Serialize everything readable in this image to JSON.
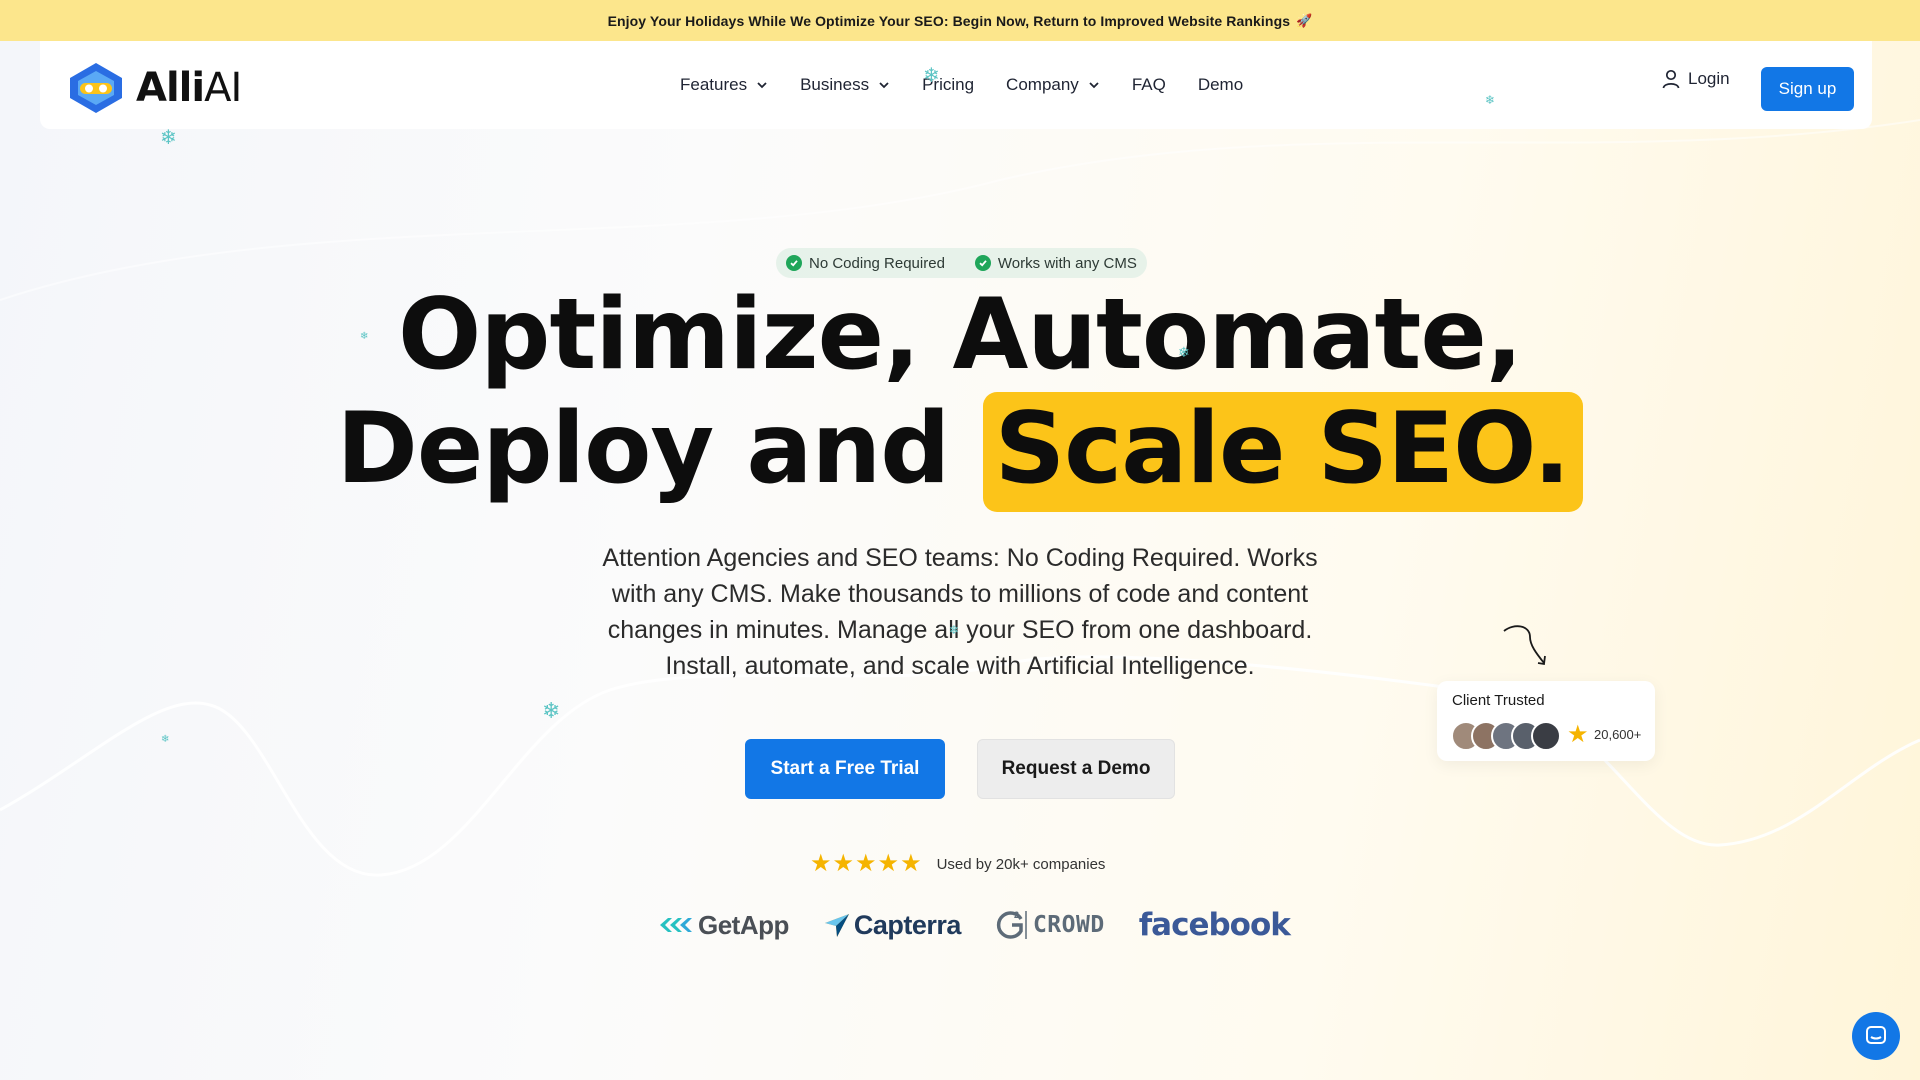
{
  "promo": {
    "text": "Enjoy Your Holidays While We Optimize Your SEO: Begin Now, Return to Improved Website Rankings",
    "icon": "rocket-icon"
  },
  "nav": {
    "logo_bold": "Alli",
    "logo_light": "AI",
    "items": [
      {
        "label": "Features",
        "dropdown": true
      },
      {
        "label": "Business",
        "dropdown": true
      },
      {
        "label": "Pricing",
        "dropdown": false
      },
      {
        "label": "Company",
        "dropdown": true
      },
      {
        "label": "FAQ",
        "dropdown": false
      },
      {
        "label": "Demo",
        "dropdown": false
      }
    ],
    "login": "Login",
    "signup": "Sign up"
  },
  "hero": {
    "badges": [
      "No Coding Required",
      "Works with any CMS"
    ],
    "headline_line1": "Optimize, Automate,",
    "headline_line2_plain": "Deploy and",
    "headline_line2_highlight": "Scale SEO.",
    "subtext": "Attention Agencies and SEO teams: No Coding Required. Works with any CMS. Make thousands to millions of code and content changes in minutes. Manage all your SEO from one dashboard. Install, automate, and scale with Artificial Intelligence.",
    "cta_primary": "Start a Free Trial",
    "cta_secondary": "Request a Demo",
    "rating_stars": 5,
    "rating_text": "Used by 20k+ companies",
    "brands": [
      "GetApp",
      "Capterra",
      "CROWD",
      "facebook"
    ]
  },
  "trust_card": {
    "title": "Client Trusted",
    "count": "20,600+"
  },
  "colors": {
    "accent_blue": "#1277e6",
    "highlight_yellow": "#fcc419",
    "banner_yellow": "#fce68c",
    "check_green": "#1fa65a",
    "star_gold": "#f5b400"
  }
}
